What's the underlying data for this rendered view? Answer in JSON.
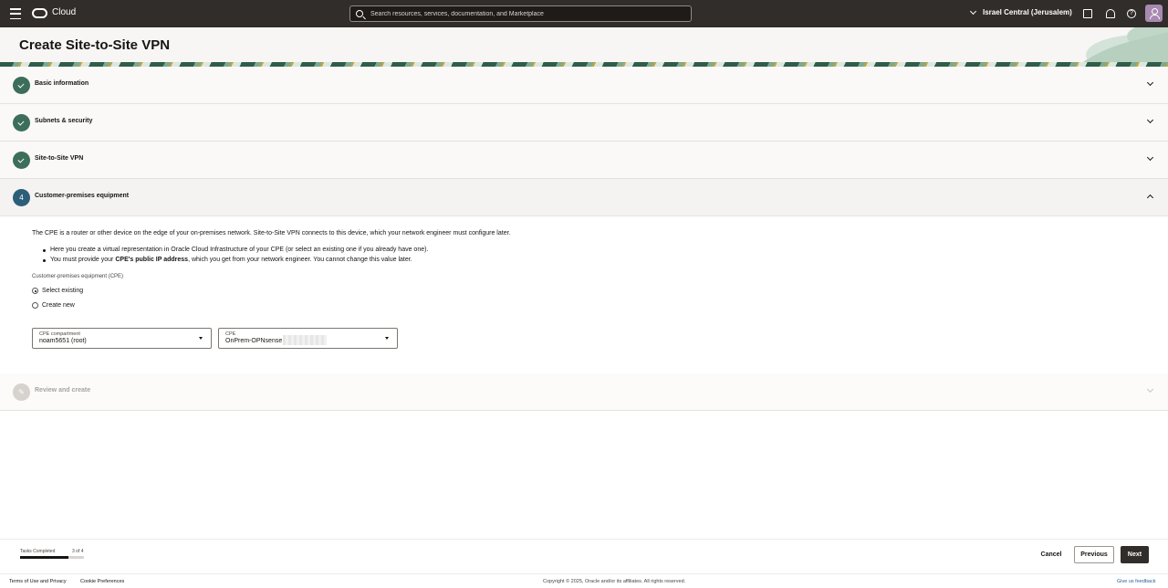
{
  "topbar": {
    "brand": "Cloud",
    "search_placeholder": "Search resources, services, documentation, and Marketplace",
    "region": "Israel Central (Jerusalem)"
  },
  "page": {
    "title": "Create Site-to-Site VPN"
  },
  "steps": [
    {
      "label": "Basic information",
      "state": "complete"
    },
    {
      "label": "Subnets & security",
      "state": "complete"
    },
    {
      "label": "Site-to-Site VPN",
      "state": "complete"
    },
    {
      "label": "Customer-premises equipment",
      "number": "4",
      "state": "current"
    },
    {
      "label": "Review and create",
      "state": "disabled"
    }
  ],
  "cpe": {
    "intro": "The CPE is a router or other device on the edge of your on-premises network. Site-to-Site VPN connects to this device, which your network engineer must configure later.",
    "bullet1": "Here you create a virtual representation in Oracle Cloud Infrastructure of your CPE (or select an existing one if you already have one).",
    "bullet2_pre": "You must provide your ",
    "bullet2_bold": "CPE's public IP address",
    "bullet2_post": ", which you get from your network engineer. You cannot change this value later.",
    "section_label": "Customer-premises equipment (CPE)",
    "option_existing": "Select existing",
    "option_new": "Create new",
    "compartment_label": "CPE compartment",
    "compartment_value": "noam5651 (root)",
    "cpe_label": "CPE",
    "cpe_value": "OnPrem-OPNsense"
  },
  "footer": {
    "tasks_label": "Tasks Completed",
    "tasks_count": "3 of 4",
    "tasks_progress": 0.75,
    "cancel": "Cancel",
    "previous": "Previous",
    "next": "Next"
  },
  "legal": {
    "terms": "Terms of Use and Privacy",
    "cookies": "Cookie Preferences",
    "copyright": "Copyright © 2025, Oracle and/or its affiliates. All rights reserved.",
    "feedback": "Give us feedback"
  },
  "colors": {
    "topbar": "#312d2a",
    "complete": "#3c6e5a",
    "current": "#2c5e7a"
  }
}
